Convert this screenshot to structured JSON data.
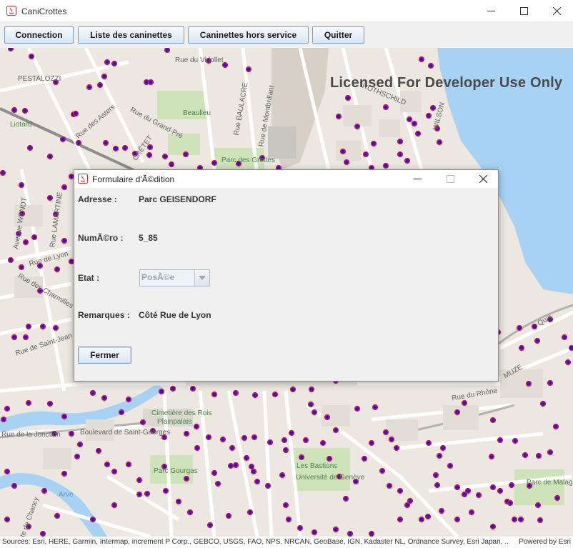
{
  "window": {
    "title": "CaniCrottes"
  },
  "toolbar": {
    "connection": "Connection",
    "liste": "Liste des caninettes",
    "hors_service": "Caninettes hors service",
    "quitter": "Quitter"
  },
  "map": {
    "watermark": "Licensed For Developer Use Only",
    "attribution_sources": "Sources: Esri, HERE, Garmin, Intermap, increment P Corp., GEBCO, USGS, FAO, NPS, NRCAN, GeoBase, IGN, Kadaster NL, Ordnance Survey, Esri Japan, ...",
    "attribution_powered": "Powered by Esri",
    "marker_color": "#2b18d8",
    "marker_ring": "#e0183a",
    "labels": {
      "pestalozzi": "PESTALOZZI",
      "vidollet": "Rue du Vidollet",
      "beaulieu": "Beaulieu",
      "grand_pre": "Rue du Grand-Pré",
      "asters": "Rue des Asters",
      "cretet": "CRÊTET",
      "baulacre": "Rue BAULACRE",
      "montbrillant": "Rue de Montbrillant",
      "parc_grottes": "Parc des Grottes",
      "rothschild": "ROTHSCHILD",
      "wilson": "WILSON",
      "liotard": "Liotard",
      "lamartine": "Rue LAMARTINE",
      "wendt": "Avenue WENDT",
      "lyon": "Rue de Lyon",
      "charmilles": "Rue des Charmilles",
      "saint_jean": "Rue de Saint-Jean",
      "cimetiere": "Cimetière des Rois",
      "plainpalais": "Plainpalais",
      "jonction": "Rue de la Jonction",
      "bd_saint_georges": "Boulevard de Saint-Georges",
      "parc_gourgas": "Parc Gourgas",
      "arve": "Arve",
      "bastions": "Les Bastions",
      "universite": "Université de Genève",
      "rhone": "Rue du Rhône",
      "parc_malagnou": "Parc de Malagnou",
      "quai": "Quai",
      "chancy": "Route de Chancy",
      "muze": "MUZE"
    }
  },
  "dialog": {
    "title": "Formulaire d'Ã©dition",
    "adresse_label": "Adresse :",
    "adresse_value": "Parc GEISENDORF",
    "numero_label": "NumÃ©ro :",
    "numero_value": "5_85",
    "etat_label": "Etat :",
    "etat_value": "PosÃ©e",
    "remarques_label": "Remarques :",
    "remarques_value": "Côté Rue de Lyon",
    "fermer": "Fermer"
  }
}
